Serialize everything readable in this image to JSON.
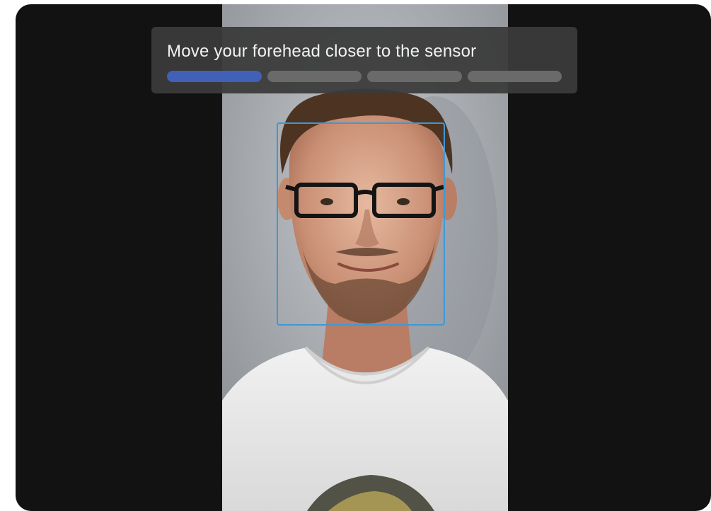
{
  "prompt": {
    "instruction": "Move your forehead closer to the sensor"
  },
  "progress": {
    "total_steps": 4,
    "current_step": 1,
    "steps": [
      {
        "state": "active"
      },
      {
        "state": "pending"
      },
      {
        "state": "pending"
      },
      {
        "state": "pending"
      }
    ]
  },
  "colors": {
    "background": "#121212",
    "panel": "#3a3a3a",
    "progress_active": "#4161b8",
    "progress_inactive": "#6a6a6a",
    "face_box": "#3f98d6"
  }
}
